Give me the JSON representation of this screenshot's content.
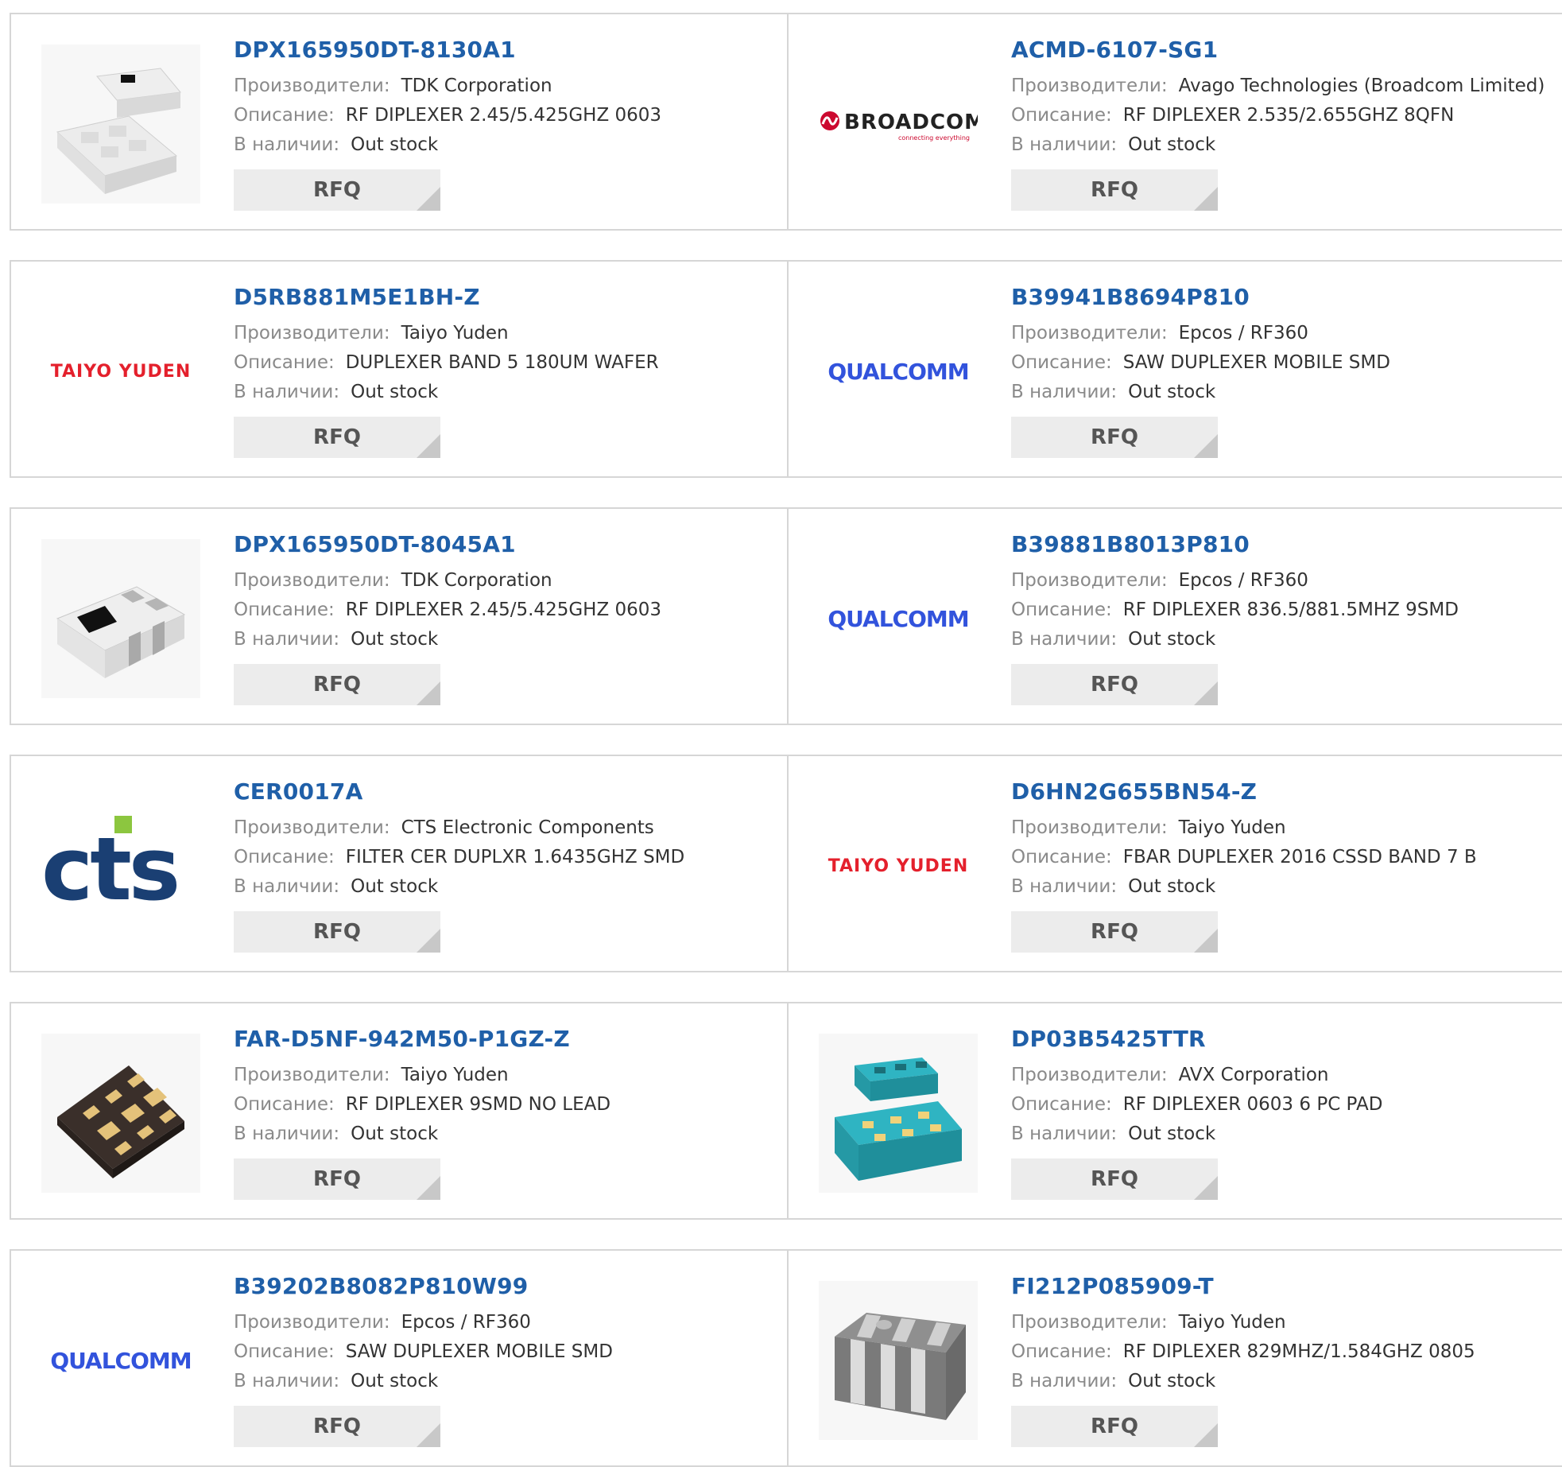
{
  "labels": {
    "manufacturer": "Производители:",
    "description": "Описание:",
    "stock": "В наличии:",
    "rfq": "RFQ"
  },
  "colors": {
    "part_link": "#1f5fa8",
    "label_gray": "#8a8a8a",
    "rfq_bg": "#ececec",
    "taiyo_red": "#e4202c",
    "qualcomm_blue": "#3253dc",
    "cts_blue": "#1a3f73",
    "cts_green": "#8cc63f",
    "broadcom_red": "#cc092f",
    "teal_part": "#2fb4c2"
  },
  "products": [
    {
      "part": "DPX165950DT-8130A1",
      "manufacturer": "TDK Corporation",
      "description": "RF DIPLEXER 2.45/5.425GHZ 0603",
      "stock": "Out stock",
      "image": "white-chip-pair"
    },
    {
      "part": "ACMD-6107-SG1",
      "manufacturer": "Avago Technologies (Broadcom Limited)",
      "description": "RF DIPLEXER 2.535/2.655GHZ 8QFN",
      "stock": "Out stock",
      "image": "broadcom-logo",
      "logo_text": "BROADCOM",
      "logo_tagline": "connecting everything"
    },
    {
      "part": "D5RB881M5E1BH-Z",
      "manufacturer": "Taiyo Yuden",
      "description": "DUPLEXER BAND 5 180UM WAFER",
      "stock": "Out stock",
      "image": "taiyo-yuden-logo",
      "logo_text": "TAIYO YUDEN"
    },
    {
      "part": "B39941B8694P810",
      "manufacturer": "Epcos / RF360",
      "description": "SAW DUPLEXER MOBILE SMD",
      "stock": "Out stock",
      "image": "qualcomm-logo",
      "logo_text": "QUALCOMM"
    },
    {
      "part": "DPX165950DT-8045A1",
      "manufacturer": "TDK Corporation",
      "description": "RF DIPLEXER 2.45/5.425GHZ 0603",
      "stock": "Out stock",
      "image": "white-chip-striped"
    },
    {
      "part": "B39881B8013P810",
      "manufacturer": "Epcos / RF360",
      "description": "RF DIPLEXER 836.5/881.5MHZ 9SMD",
      "stock": "Out stock",
      "image": "qualcomm-logo",
      "logo_text": "QUALCOMM"
    },
    {
      "part": "CER0017A",
      "manufacturer": "CTS Electronic Components",
      "description": "FILTER CER DUPLXR 1.6435GHZ SMD",
      "stock": "Out stock",
      "image": "cts-logo",
      "logo_text": "cts"
    },
    {
      "part": "D6HN2G655BN54-Z",
      "manufacturer": "Taiyo Yuden",
      "description": "FBAR DUPLEXER 2016 CSSD BAND 7 B",
      "stock": "Out stock",
      "image": "taiyo-yuden-logo",
      "logo_text": "TAIYO YUDEN"
    },
    {
      "part": "FAR-D5NF-942M50-P1GZ-Z",
      "manufacturer": "Taiyo Yuden",
      "description": "RF DIPLEXER 9SMD NO LEAD",
      "stock": "Out stock",
      "image": "dark-chip-gold-pads"
    },
    {
      "part": "DP03B5425TTR",
      "manufacturer": "AVX Corporation",
      "description": "RF DIPLEXER 0603 6 PC PAD",
      "stock": "Out stock",
      "image": "teal-chip-pair"
    },
    {
      "part": "B39202B8082P810W99",
      "manufacturer": "Epcos / RF360",
      "description": "SAW DUPLEXER MOBILE SMD",
      "stock": "Out stock",
      "image": "qualcomm-logo",
      "logo_text": "QUALCOMM"
    },
    {
      "part": "FI212P085909-T",
      "manufacturer": "Taiyo Yuden",
      "description": "RF DIPLEXER 829MHZ/1.584GHZ 0805",
      "stock": "Out stock",
      "image": "gray-chip-striped"
    }
  ]
}
